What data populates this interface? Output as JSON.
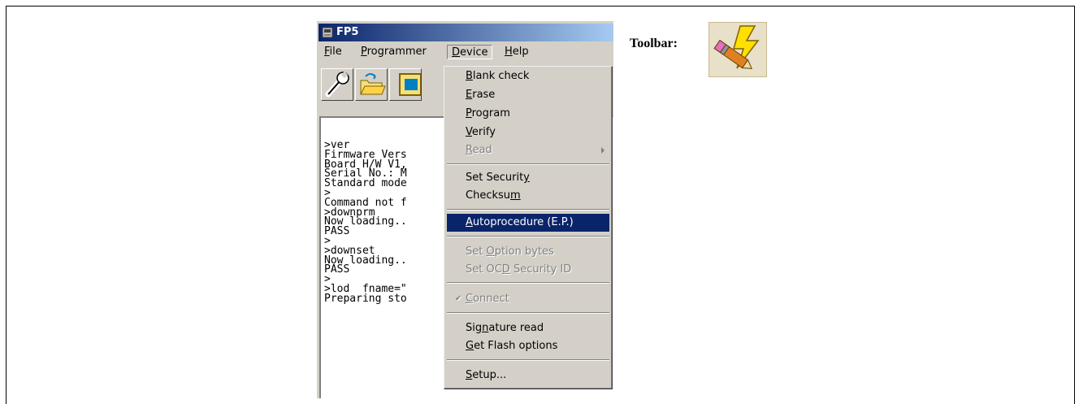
{
  "window": {
    "title": "FP5"
  },
  "menubar": {
    "items": [
      {
        "label": "File",
        "u": "F",
        "rest": "ile"
      },
      {
        "label": "Programmer",
        "u": "P",
        "rest": "rogrammer"
      },
      {
        "label": "Device",
        "u": "D",
        "rest": "evice"
      },
      {
        "label": "Help",
        "u": "H",
        "rest": "elp"
      }
    ]
  },
  "toolbar": {
    "buttons": [
      "wrench-icon",
      "folder-icon",
      "board-icon"
    ]
  },
  "console": {
    "lines": [
      ">ver",
      "Firmware Vers",
      "Board H/W V1,",
      "Serial No.: M",
      "Standard mode",
      ">",
      "Command not f",
      ">downprm",
      "Now loading..",
      "PASS",
      ">",
      ">downset",
      "Now loading..",
      "PASS",
      ">",
      ">lod  fname=\"",
      "Preparing sto"
    ]
  },
  "device_menu": {
    "items": [
      {
        "pre": "",
        "u": "B",
        "post": "lank check"
      },
      {
        "pre": "",
        "u": "E",
        "post": "rase"
      },
      {
        "pre": "",
        "u": "P",
        "post": "rogram"
      },
      {
        "pre": "",
        "u": "V",
        "post": "erify"
      },
      {
        "pre": "",
        "u": "R",
        "post": "ead"
      },
      {
        "pre": "Set Securit",
        "u": "y",
        "post": ""
      },
      {
        "pre": "Checksu",
        "u": "m",
        "post": ""
      },
      {
        "pre": "",
        "u": "A",
        "post": "utoprocedure (E.P.)"
      },
      {
        "pre": "Set ",
        "u": "O",
        "post": "ption bytes"
      },
      {
        "pre": "Set OC",
        "u": "D",
        "post": " Security ID"
      },
      {
        "pre": "",
        "u": "C",
        "post": "onnect"
      },
      {
        "pre": "Sig",
        "u": "n",
        "post": "ature read"
      },
      {
        "pre": "",
        "u": "G",
        "post": "et Flash options"
      },
      {
        "pre": "",
        "u": "S",
        "post": "etup..."
      }
    ]
  },
  "caption": {
    "toolbar_label": "Toolbar:"
  },
  "colors": {
    "title_active": "#0a246a",
    "menu_highlight": "#0a246a",
    "face": "#d4d0c8"
  }
}
